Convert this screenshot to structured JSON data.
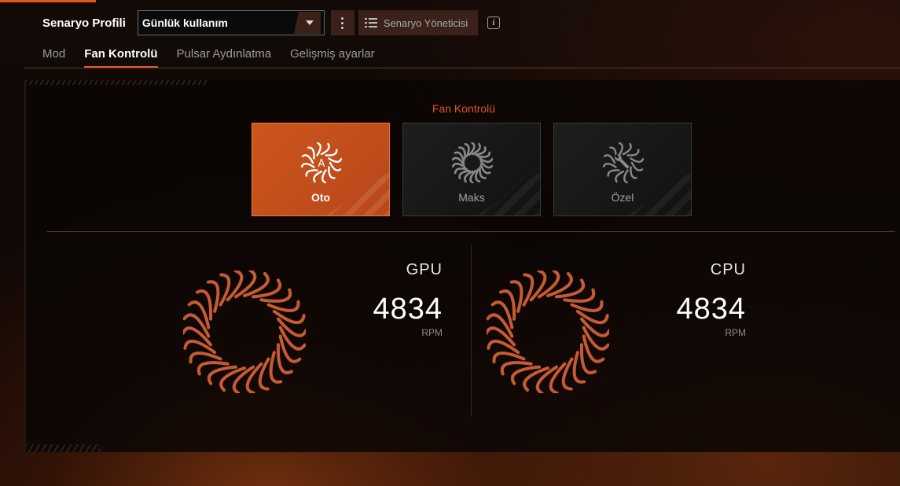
{
  "header": {
    "profile_label": "Senaryo Profili",
    "profile_value": "Günlük kullanım",
    "manager_label": "Senaryo Yöneticisi",
    "info_icon": "info-icon"
  },
  "tabs": [
    {
      "label": "Mod",
      "active": false
    },
    {
      "label": "Fan Kontrolü",
      "active": true
    },
    {
      "label": "Pulsar Aydınlatma",
      "active": false
    },
    {
      "label": "Gelişmiş ayarlar",
      "active": false
    }
  ],
  "fan_control": {
    "title": "Fan Kontrolü",
    "modes": [
      {
        "label": "Oto",
        "icon": "fan-auto-icon",
        "selected": true
      },
      {
        "label": "Maks",
        "icon": "fan-max-icon",
        "selected": false
      },
      {
        "label": "Özel",
        "icon": "fan-custom-icon",
        "selected": false
      }
    ]
  },
  "fans": [
    {
      "name": "GPU",
      "rpm": "4834",
      "unit": "RPM"
    },
    {
      "name": "CPU",
      "rpm": "4834",
      "unit": "RPM"
    }
  ],
  "colors": {
    "accent": "#e0561c",
    "card_active": "#cc561d",
    "fan_blade": "#d9653a"
  }
}
